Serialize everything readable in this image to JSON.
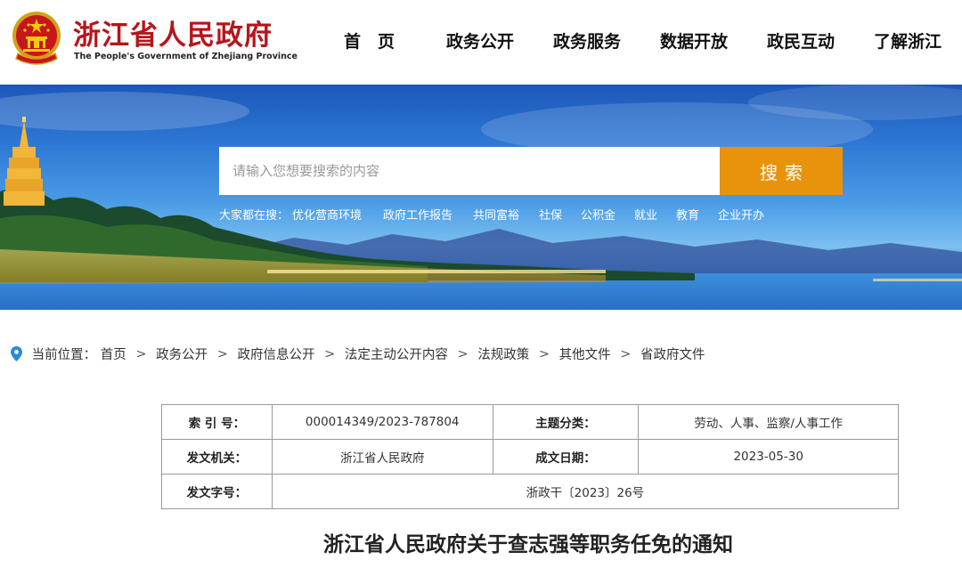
{
  "header": {
    "title": "浙江省人民政府",
    "subtitle": "The People's Government of Zhejiang Province",
    "emblem_icon": "national-emblem-icon"
  },
  "nav": {
    "items": [
      {
        "label": "首　页"
      },
      {
        "label": "政务公开"
      },
      {
        "label": "政务服务"
      },
      {
        "label": "数据开放"
      },
      {
        "label": "政民互动"
      },
      {
        "label": "了解浙江"
      }
    ]
  },
  "search": {
    "placeholder": "请输入您想要搜索的内容",
    "value": "",
    "button_label": "搜索",
    "hot_label": "大家都在搜：",
    "hot_links": [
      "优化营商环境",
      "政府工作报告",
      "共同富裕",
      "社保",
      "公积金",
      "就业",
      "教育",
      "企业开办"
    ]
  },
  "breadcrumb": {
    "icon": "location-pin-icon",
    "label": "当前位置：",
    "items": [
      "首页",
      "政务公开",
      "政府信息公开",
      "法定主动公开内容",
      "法规政策",
      "其他文件",
      "省政府文件"
    ],
    "separator": ">"
  },
  "meta": {
    "index_key": "索 引 号：",
    "index_value": "000014349/2023-787804",
    "topic_key": "主题分类：",
    "topic_value": "劳动、人事、监察/人事工作",
    "issuer_key": "发文机关：",
    "issuer_value": "浙江省人民政府",
    "date_key": "成文日期：",
    "date_value": "2023-05-30",
    "docno_key": "发文字号：",
    "docno_value": "浙政干〔2023〕26号"
  },
  "document": {
    "title": "浙江省人民政府关于查志强等职务任免的通知"
  },
  "colors": {
    "brand_red": "#b4161b",
    "search_orange": "#e8930b",
    "banner_blue": "#2f7ad6"
  }
}
